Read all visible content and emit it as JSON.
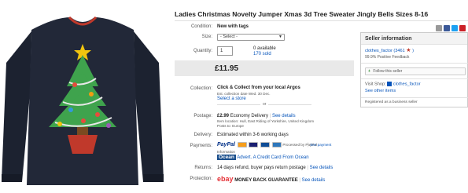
{
  "listing": {
    "title": "Ladies Christmas Novelty Jumper Xmas 3d Tree Sweater Jingly Bells Sizes 8-16",
    "condition_label": "Condition:",
    "condition_value": "New with tags",
    "size_label": "Size:",
    "size_selected": "- Select -",
    "quantity_label": "Quantity:",
    "quantity_value": "1",
    "available": "0 available",
    "sold": "170 sold",
    "price": "£11.95",
    "collection_label": "Collection:",
    "collection_title": "Click & Collect from your local Argos",
    "collection_note": "Est. collection date Wed. 30 Dec.",
    "collection_link": "Select a store",
    "or": "or",
    "postage_label": "Postage:",
    "postage_price": "£2.99",
    "postage_service": "Economy Delivery",
    "postage_details": "See details",
    "postage_location": "Item location: Hull, East Riding of Yorkshire, United Kingdom",
    "posts_to": "Posts to: Europe",
    "delivery_label": "Delivery:",
    "delivery_value": "Estimated within 3-6 working days",
    "payments_label": "Payments:",
    "paypal": "PayPal",
    "processed_by": "Processed by PayPal",
    "see_payment": "See payment",
    "info": "Information",
    "ocean_logo": "Ocean",
    "ocean_text": "Advert. A Credit Card From Ocean",
    "returns_label": "Returns:",
    "returns_value": "14 days refund, buyer pays return postage",
    "returns_details": "See details",
    "protection_label": "Protection:",
    "ebay": "ebay",
    "mbg": "MONEY BACK GUARANTEE",
    "protection_details": "See details"
  },
  "seller": {
    "heading": "Seller information",
    "name": "clothes_factor",
    "score": "(3461",
    "score_end": ")",
    "feedback": "99.9% Positive Feedback",
    "follow": "Follow this seller",
    "visit_shop": "Visit Shop:",
    "shop_name": "clothes_factor",
    "see_other": "See other items",
    "registered": "Registered as a business seller"
  },
  "colors": {
    "link": "#0654ba",
    "sweater": "#1c2230",
    "tree": "#3fa34d",
    "pot": "#c0392b"
  }
}
